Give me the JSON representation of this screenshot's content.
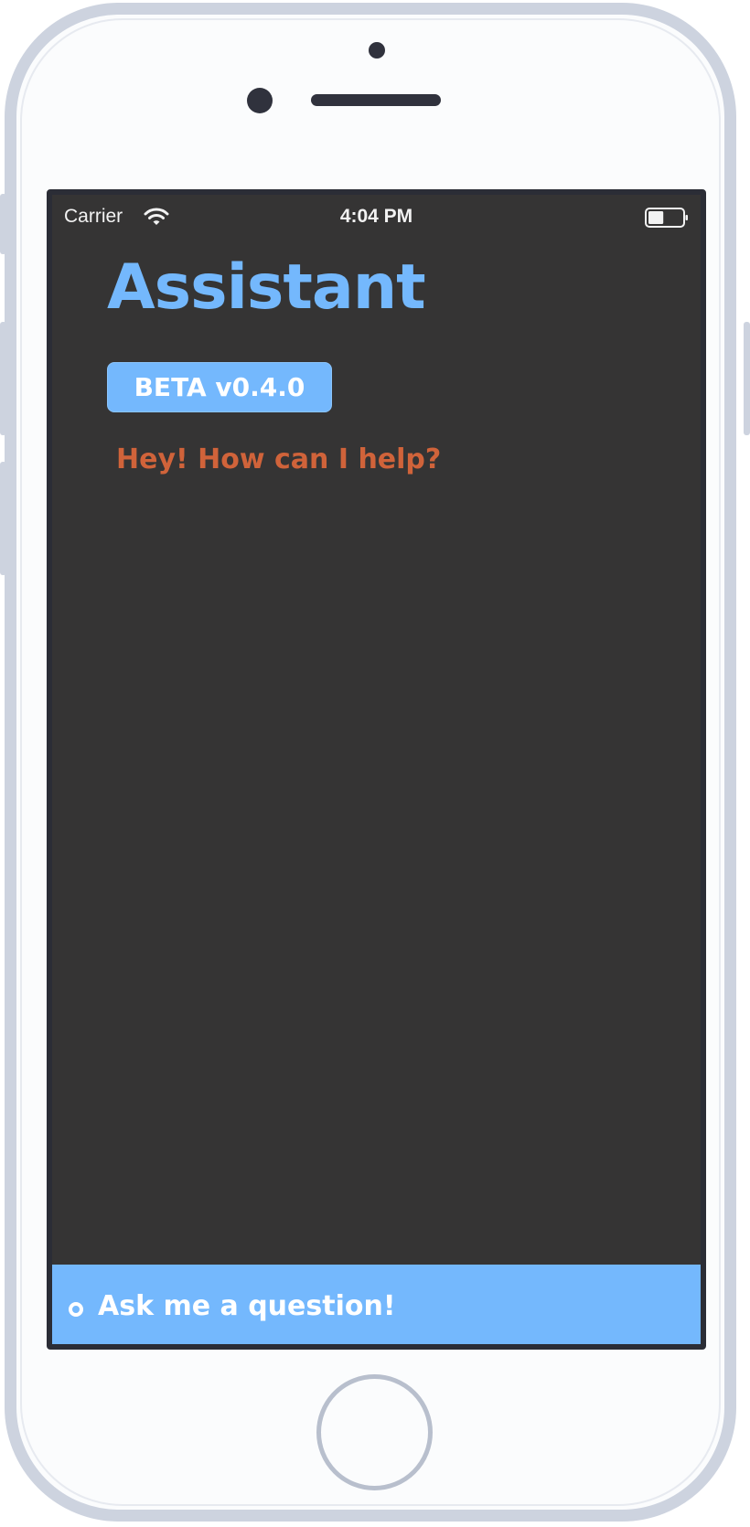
{
  "status_bar": {
    "carrier": "Carrier",
    "time": "4:04 PM",
    "wifi_icon": "wifi-icon",
    "battery_icon": "battery-icon",
    "battery_level_fraction": 0.45
  },
  "app": {
    "title": "Assistant",
    "badge": "BETA v0.4.0",
    "greeting": "Hey! How can I help?"
  },
  "input_bar": {
    "placeholder": "Ask me a question!",
    "indicator_icon": "circle-icon"
  },
  "colors": {
    "screen_background": "#353434",
    "accent_blue": "#74b8fd",
    "greeting_orange": "#d0633a",
    "device_frame": "#cdd3df"
  }
}
